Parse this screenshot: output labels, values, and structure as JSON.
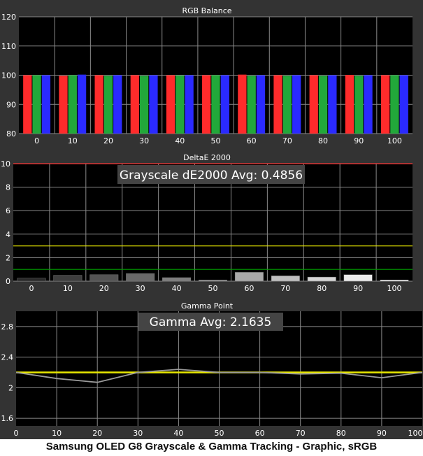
{
  "caption": "Samsung OLED G8 Grayscale & Gamma Tracking - Graphic, sRGB",
  "colors": {
    "background": "#333333",
    "plot_background": "#000000",
    "gridline": "#8a8a8a",
    "text": "#ffffff",
    "red": "#ff2b2b",
    "green": "#22a83a",
    "blue": "#2a2aff",
    "threshold_high": "#ff3b3b",
    "threshold_mid": "#e8e800",
    "threshold_low": "#00a000",
    "gamma_target": "#e8e800",
    "gamma_measured": "#9a9a9a",
    "banner_bg": "#444444"
  },
  "chart_data": [
    {
      "type": "bar",
      "title": "RGB Balance",
      "categories": [
        "0",
        "10",
        "20",
        "30",
        "40",
        "50",
        "60",
        "70",
        "80",
        "90",
        "100"
      ],
      "ylim": [
        80,
        120
      ],
      "yticks": [
        80,
        90,
        100,
        110,
        120
      ],
      "grid": true,
      "series": [
        {
          "color_key": "red",
          "values": [
            100,
            99.8,
            100,
            100,
            100,
            100,
            100.2,
            100,
            100,
            100.1,
            100
          ]
        },
        {
          "color_key": "green",
          "values": [
            100,
            100,
            99.8,
            99.8,
            99.9,
            100,
            99.8,
            99.8,
            99.8,
            99.8,
            100
          ]
        },
        {
          "color_key": "blue",
          "values": [
            100,
            100.2,
            100,
            100,
            100,
            100,
            100,
            100,
            100,
            100,
            100
          ]
        }
      ]
    },
    {
      "type": "bar",
      "title": "DeltaE 2000",
      "banner": "Grayscale dE2000 Avg: 0.4856",
      "categories": [
        "0",
        "10",
        "20",
        "30",
        "40",
        "50",
        "60",
        "70",
        "80",
        "90",
        "100"
      ],
      "values": [
        0.25,
        0.5,
        0.55,
        0.65,
        0.3,
        0.1,
        0.75,
        0.45,
        0.35,
        0.55,
        0.1
      ],
      "ylim": [
        0,
        10
      ],
      "yticks": [
        0,
        2,
        4,
        6,
        8,
        10
      ],
      "thresholds": [
        {
          "value": 10,
          "color_key": "threshold_high"
        },
        {
          "value": 3,
          "color_key": "threshold_mid"
        },
        {
          "value": 1,
          "color_key": "threshold_low"
        }
      ],
      "grid": true
    },
    {
      "type": "line",
      "title": "Gamma Point",
      "banner": "Gamma Avg: 2.1635",
      "x": [
        0,
        10,
        20,
        30,
        40,
        50,
        60,
        70,
        80,
        90,
        100
      ],
      "series": [
        {
          "color_key": "gamma_target",
          "values": [
            2.2,
            2.2,
            2.2,
            2.2,
            2.2,
            2.2,
            2.2,
            2.2,
            2.2,
            2.2,
            2.2
          ]
        },
        {
          "color_key": "gamma_measured",
          "values": [
            2.2,
            2.12,
            2.07,
            2.2,
            2.24,
            2.2,
            2.2,
            2.18,
            2.19,
            2.13,
            2.2
          ]
        }
      ],
      "xlim": [
        0,
        100
      ],
      "ylim": [
        1.5,
        3.0
      ],
      "yticks": [
        1.6,
        2,
        2.4,
        2.8
      ],
      "ytick_labels": [
        "1.6",
        "2",
        "2.4",
        "2.8"
      ],
      "xticks": [
        0,
        10,
        20,
        30,
        40,
        50,
        60,
        70,
        80,
        90,
        100
      ],
      "grid": true
    }
  ]
}
